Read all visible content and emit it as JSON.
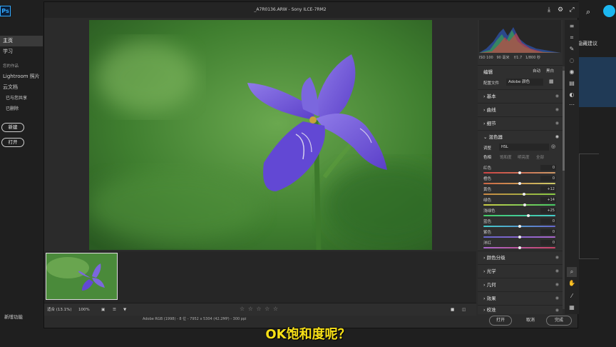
{
  "ps_home": {
    "logo": "Ps",
    "nav": [
      {
        "label": "主页",
        "active": true
      },
      {
        "label": "学习",
        "active": false
      }
    ],
    "your_work_heading": "您的作品",
    "work_items": [
      "Lightroom 照片",
      "云文档"
    ],
    "sub_items": [
      "已与您共享",
      "已删除"
    ],
    "new_button": "新建",
    "open_button": "打开",
    "whats_new": "新增功能",
    "suggestion_text": "隐藏建议"
  },
  "acr": {
    "title": "_A7R0136.ARW - Sony ILCE-7RM2",
    "camera_info": [
      "ISO 100",
      "90 毫米",
      "f/1.7",
      "1/800 秒"
    ],
    "edit_label": "编辑",
    "auto_label": "自动",
    "bw_label": "黑白",
    "profile_label": "配置文件",
    "profile_value": "Adobe 颜色",
    "sections_top": [
      "基本",
      "曲线",
      "细节"
    ],
    "mixer": {
      "title": "混色器",
      "adjust_label": "调整",
      "adjust_value": "HSL",
      "tabs": [
        "色相",
        "饱和度",
        "明亮度",
        "全部"
      ],
      "rows": [
        {
          "label": "红色",
          "value": "0",
          "pos": 0.5,
          "gradient": "linear-gradient(90deg,#c44,#c96)"
        },
        {
          "label": "橙色",
          "value": "0",
          "pos": 0.5,
          "gradient": "linear-gradient(90deg,#c64,#cc6)"
        },
        {
          "label": "黄色",
          "value": "+12",
          "pos": 0.56,
          "gradient": "linear-gradient(90deg,#c84,#8c4)"
        },
        {
          "label": "绿色",
          "value": "+14",
          "pos": 0.57,
          "gradient": "linear-gradient(90deg,#cc4,#4c6)"
        },
        {
          "label": "浅绿色",
          "value": "+25",
          "pos": 0.62,
          "gradient": "linear-gradient(90deg,#4c6,#4cc)"
        },
        {
          "label": "蓝色",
          "value": "0",
          "pos": 0.5,
          "gradient": "linear-gradient(90deg,#4cc,#66c)"
        },
        {
          "label": "紫色",
          "value": "0",
          "pos": 0.5,
          "gradient": "linear-gradient(90deg,#66c,#a6c)"
        },
        {
          "label": "洋红",
          "value": "0",
          "pos": 0.5,
          "gradient": "linear-gradient(90deg,#a6c,#c46)"
        }
      ]
    },
    "sections_bottom": [
      "颜色分级",
      "光学",
      "几何",
      "效果",
      "校准"
    ],
    "zoom_fit": "适合 (13.1%)",
    "zoom_pct": "100%",
    "stars": "☆ ☆ ☆ ☆ ☆",
    "footer_info": "Adobe RGB (1998) - 8 位 - 7952 x 5304 (42.2MP) - 300 ppi",
    "open_btn": "打开",
    "cancel_btn": "取消",
    "done_btn": "完成"
  },
  "subtitle": "OK饱和度呢？",
  "colors": {
    "ps_blue": "#31a8ff",
    "avatar": "#1cb7f0",
    "subtitle": "#f7e017"
  }
}
